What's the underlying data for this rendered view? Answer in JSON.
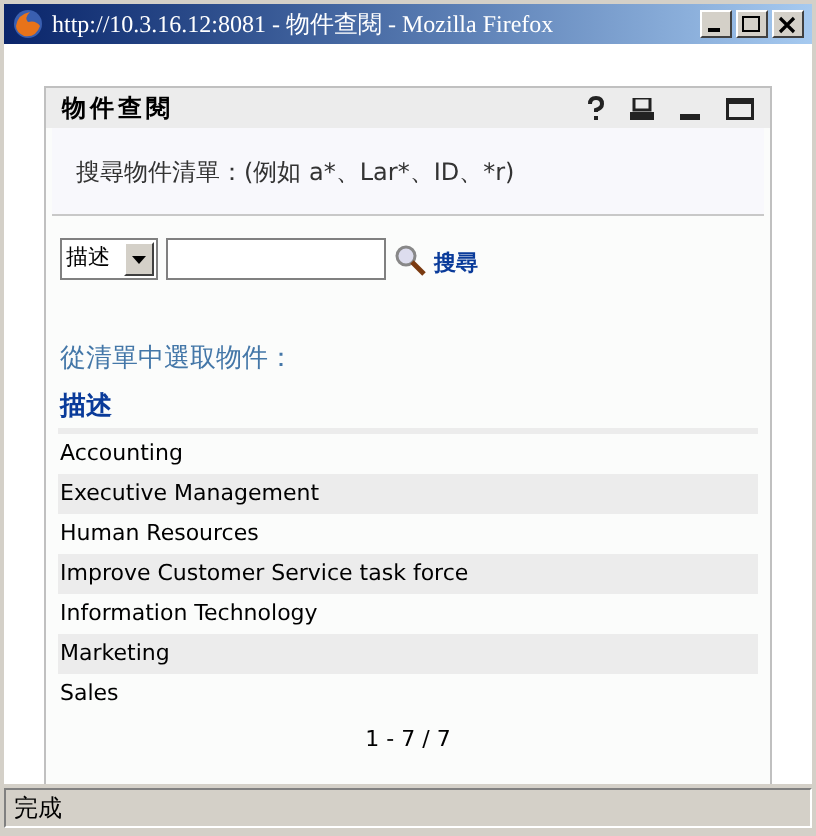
{
  "window": {
    "title": "http://10.3.16.12:8081 - 物件查閱 - Mozilla Firefox"
  },
  "panel": {
    "title": "物件查閱",
    "hint": "搜尋物件清單：(例如 a*、Lar*、ID、*r)"
  },
  "search": {
    "field_select": "描述",
    "button": "搜尋"
  },
  "list": {
    "heading": "從清單中選取物件：",
    "column": "描述",
    "rows": [
      "Accounting",
      "Executive Management",
      "Human Resources",
      "Improve Customer Service task force",
      "Information Technology",
      "Marketing",
      "Sales"
    ],
    "pagination": "1 - 7 / 7"
  },
  "status_bar": "完成"
}
